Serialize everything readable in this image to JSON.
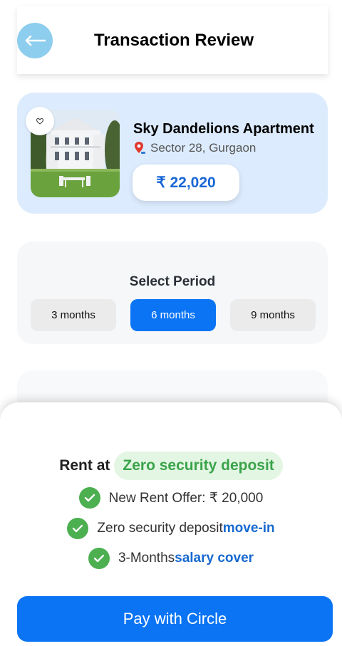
{
  "header": {
    "title": "Transaction Review",
    "back_icon": "arrow-left-icon",
    "back_color": "#8dcdee"
  },
  "property": {
    "name": "Sky Dandelions Apartment",
    "location": "Sector 28, Gurgaon",
    "price": "₹ 22,020",
    "fav_icon": "heart-icon",
    "location_icon": "map-pin-icon",
    "card_color": "#dcebfd"
  },
  "period": {
    "title": "Select Period",
    "options": [
      "3 months",
      "6 months",
      "9 months"
    ],
    "selected": "6 months",
    "accent": "#0a74f5"
  },
  "offer": {
    "rent_label": "Rent at",
    "badge": "Zero security deposit",
    "benefits": [
      {
        "text": "New Rent Offer: ₹ 20,000",
        "highlight": ""
      },
      {
        "text": "Zero security deposit",
        "highlight": "move-in"
      },
      {
        "text": "3-Months",
        "highlight": "salary cover"
      }
    ],
    "check_color": "#4caf50"
  },
  "pay": {
    "label": "Pay with Circle"
  }
}
